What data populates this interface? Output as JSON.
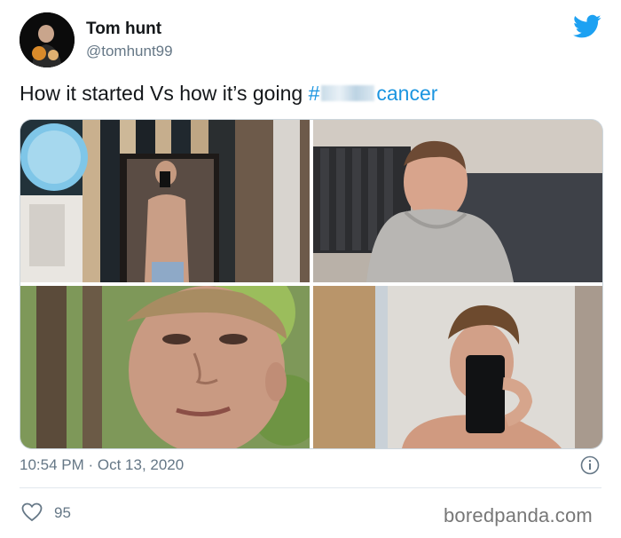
{
  "author": {
    "name": "Tom hunt",
    "handle": "@tomhunt99",
    "avatar_icon": "avatar-photo"
  },
  "tweet": {
    "text_before": "How it started  Vs how it’s going ",
    "hashtag_prefix": "#",
    "hashtag_suffix": "cancer",
    "hashtag_color": "#1b95e0"
  },
  "media": {
    "photos": [
      {
        "name": "mirror-selfie-bedroom"
      },
      {
        "name": "smiling-hoodie-photo"
      },
      {
        "name": "close-up-outdoors"
      },
      {
        "name": "mirror-selfie-phone"
      }
    ]
  },
  "meta": {
    "timestamp": "10:54 PM · Oct 13, 2020",
    "likes": "95"
  },
  "icons": {
    "brand": "twitter-bird-icon",
    "info": "info-icon",
    "like": "heart-icon"
  },
  "colors": {
    "brand_blue": "#1da1f2",
    "text_secondary": "#657786"
  },
  "watermark": "boredpanda.com"
}
